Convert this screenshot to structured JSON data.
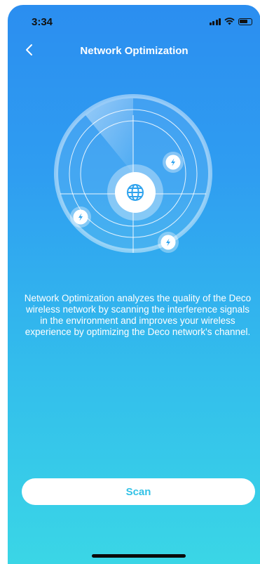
{
  "status_bar": {
    "time": "3:34"
  },
  "nav": {
    "title": "Network Optimization"
  },
  "main": {
    "description": "Network Optimization analyzes the quality of the Deco wireless network by scanning the interference signals in the environment and improves your wireless experience by optimizing the Deco network's channel."
  },
  "scan_button": {
    "label": "Scan"
  },
  "icons": [
    "back-chevron-icon",
    "globe-icon",
    "lightning-icon",
    "signal-icon",
    "wifi-icon",
    "battery-icon"
  ],
  "colors": {
    "gradient_top": "#2b8ef0",
    "gradient_bottom": "#3ad6e6",
    "accent": "#33c2e6"
  }
}
